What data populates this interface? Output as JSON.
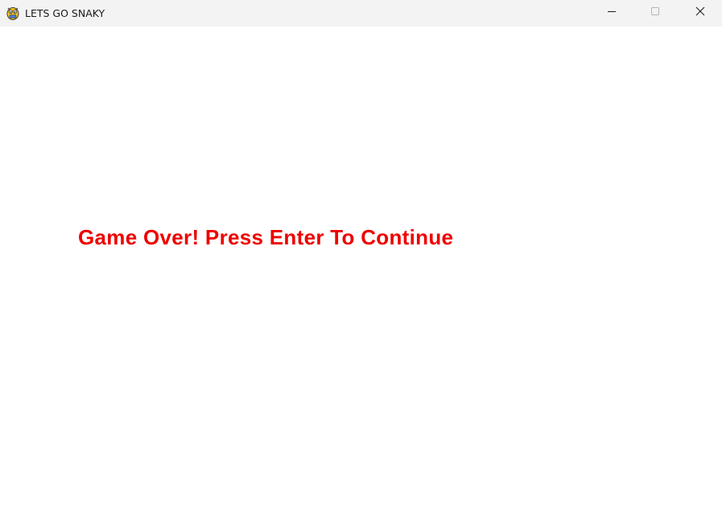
{
  "window": {
    "title": "LETS GO SNAKY",
    "app_icon": "pygame-snake-icon",
    "controls": {
      "minimize_icon": "minimize-icon",
      "maximize_icon": "maximize-icon",
      "close_icon": "close-icon"
    },
    "titlebar_color": "#f3f3f3"
  },
  "game": {
    "background_color": "#ffffff",
    "message": "Game Over! Press Enter To Continue",
    "message_color": "#ee0000"
  }
}
